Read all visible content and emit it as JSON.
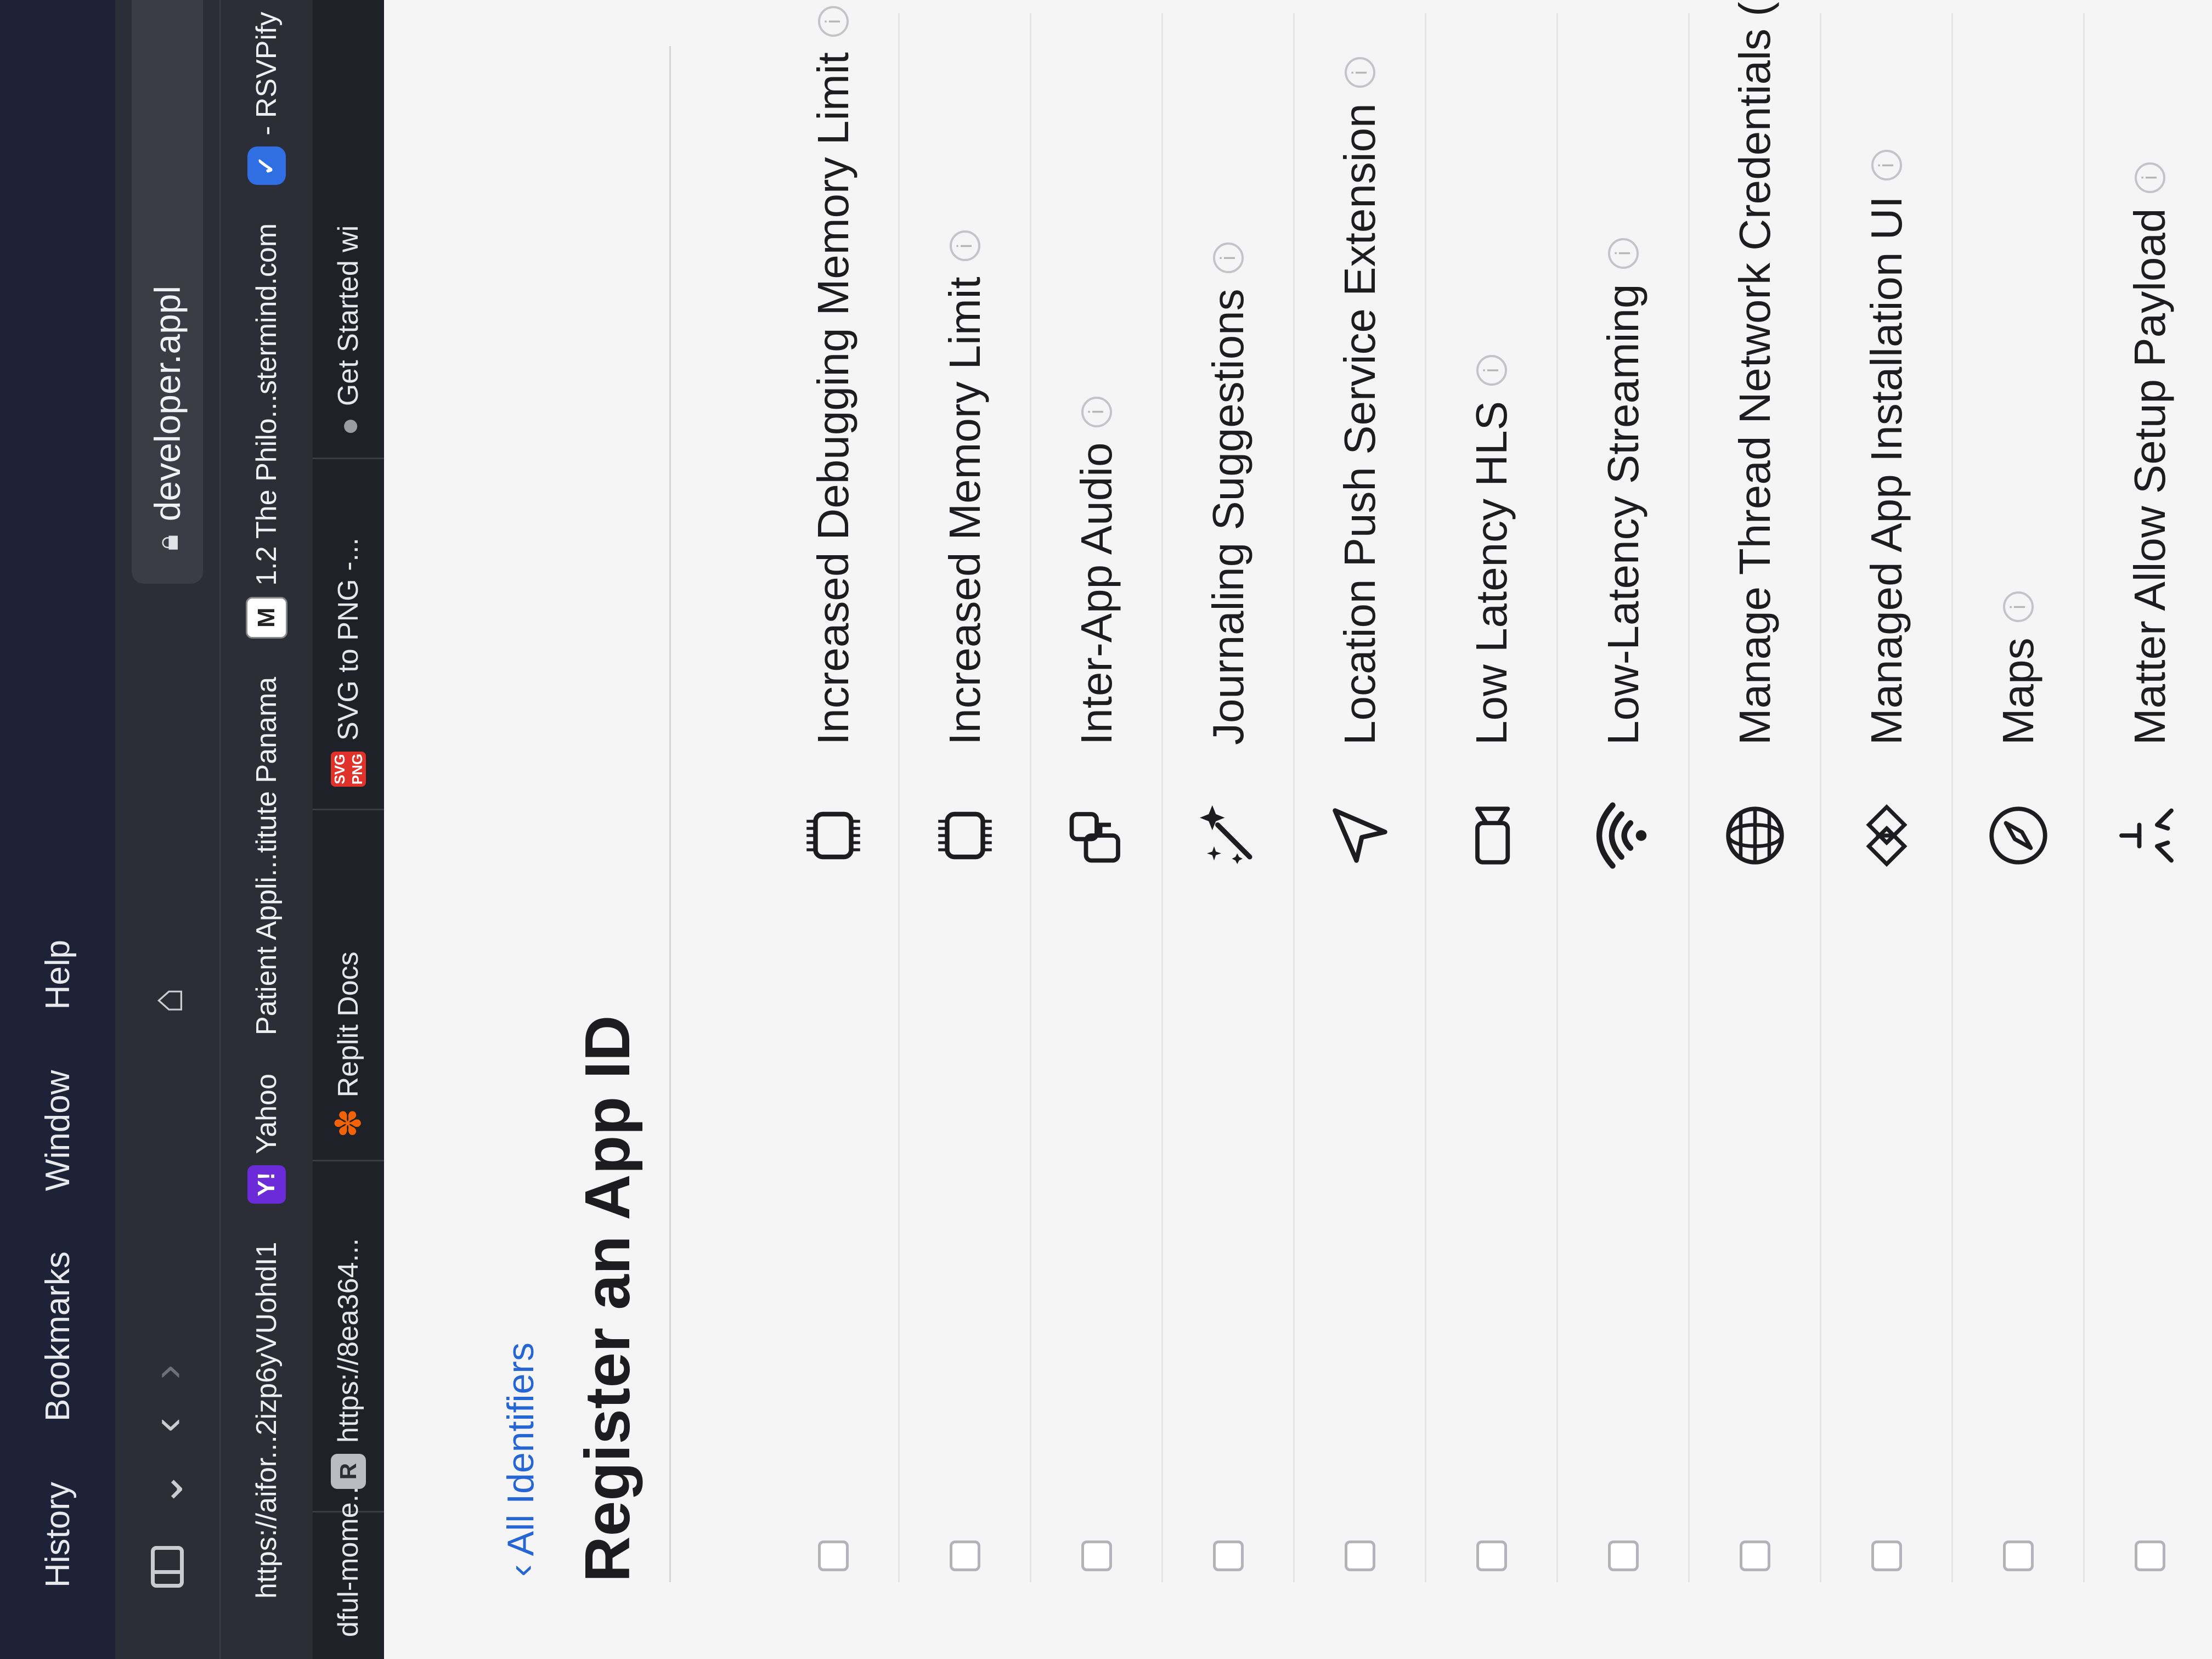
{
  "menubar": {
    "items": [
      "History",
      "Bookmarks",
      "Window",
      "Help"
    ]
  },
  "toolbar": {
    "url_host": "developer.appl"
  },
  "bookmarks": [
    {
      "label": "https://aifor...2izp6yVUohdI1",
      "badge": ""
    },
    {
      "label": "Yahoo",
      "badge": "Y!"
    },
    {
      "label": "Patient Appli...titute Panama",
      "badge": ""
    },
    {
      "label": "1.2 The Philo...stermind.com",
      "badge": "M"
    },
    {
      "label": "- RSVPify",
      "badge": "✓"
    }
  ],
  "tabs": [
    {
      "label": "dful-mome...",
      "badge": ""
    },
    {
      "label": "https://8ea364...",
      "badge": "R"
    },
    {
      "label": "Replit Docs",
      "badge": "replit"
    },
    {
      "label": "SVG to PNG -...",
      "badge": "SVG\nPNG"
    },
    {
      "label": "Get Started wi",
      "badge": "apple"
    }
  ],
  "page": {
    "back_link": "‹ All Identifiers",
    "title": "Register an App ID"
  },
  "capabilities": [
    {
      "label": "Increased Debugging Memory Limit",
      "icon": "chip-icon",
      "info": true
    },
    {
      "label": "Increased Memory Limit",
      "icon": "chip-icon",
      "info": true
    },
    {
      "label": "Inter-App Audio",
      "icon": "inter-app-audio-icon",
      "info": true
    },
    {
      "label": "Journaling Suggestions",
      "icon": "magic-wand-icon",
      "info": true
    },
    {
      "label": "Location Push Service Extension",
      "icon": "location-arrow-icon",
      "info": true
    },
    {
      "label": "Low Latency HLS",
      "icon": "video-camera-icon",
      "info": true
    },
    {
      "label": "Low-Latency Streaming",
      "icon": "wifi-icon",
      "info": true
    },
    {
      "label": "Manage Thread Network Credentials (development)",
      "icon": "globe-icon",
      "info": true
    },
    {
      "label": "Managed App Installation UI",
      "icon": "app-install-icon",
      "info": true
    },
    {
      "label": "Maps",
      "icon": "compass-icon",
      "info": true
    },
    {
      "label": "Matter Allow Setup Payload",
      "icon": "matter-icon",
      "info": true
    }
  ],
  "info_glyph": "i"
}
